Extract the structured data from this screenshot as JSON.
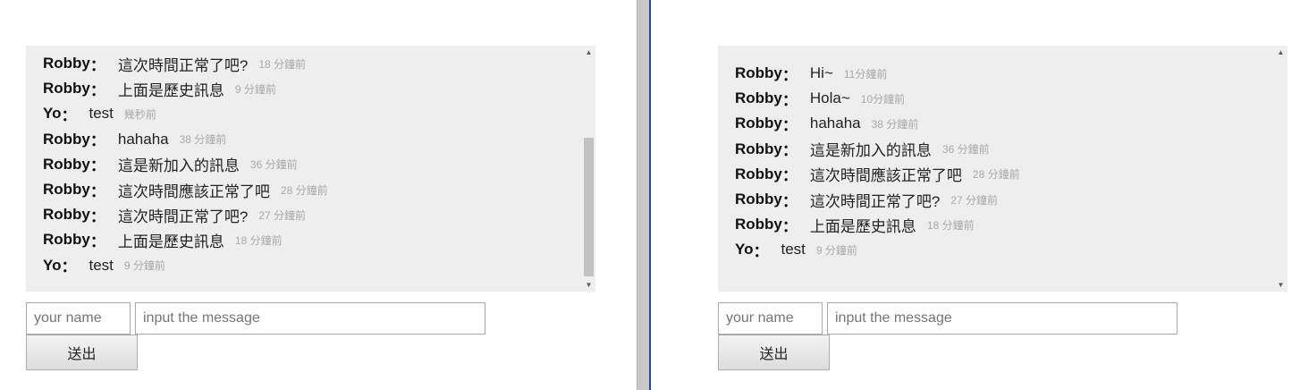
{
  "panes": [
    {
      "messages": [
        {
          "name": "Robby",
          "text": "這次時間正常了吧?",
          "time": "18 分鐘前"
        },
        {
          "name": "Robby",
          "text": "上面是歷史訊息",
          "time": "9 分鐘前"
        },
        {
          "name": "Yo",
          "text": "test",
          "time": "幾秒前"
        },
        {
          "name": "Robby",
          "text": "hahaha",
          "time": "38 分鐘前"
        },
        {
          "name": "Robby",
          "text": "這是新加入的訊息",
          "time": "36 分鐘前"
        },
        {
          "name": "Robby",
          "text": "這次時間應該正常了吧",
          "time": "28 分鐘前"
        },
        {
          "name": "Robby",
          "text": "這次時間正常了吧?",
          "time": "27 分鐘前"
        },
        {
          "name": "Robby",
          "text": "上面是歷史訊息",
          "time": "18 分鐘前"
        },
        {
          "name": "Yo",
          "text": "test",
          "time": "9 分鐘前"
        }
      ],
      "name_placeholder": "your name",
      "message_placeholder": "input the message",
      "send_label": "送出"
    },
    {
      "messages": [
        {
          "name": "Robby",
          "text": "Hi~",
          "time": "11分鐘前"
        },
        {
          "name": "Robby",
          "text": "Hola~",
          "time": "10分鐘前"
        },
        {
          "name": "Robby",
          "text": "hahaha",
          "time": "38 分鐘前"
        },
        {
          "name": "Robby",
          "text": "這是新加入的訊息",
          "time": "36 分鐘前"
        },
        {
          "name": "Robby",
          "text": "這次時間應該正常了吧",
          "time": "28 分鐘前"
        },
        {
          "name": "Robby",
          "text": "這次時間正常了吧?",
          "time": "27 分鐘前"
        },
        {
          "name": "Robby",
          "text": "上面是歷史訊息",
          "time": "18 分鐘前"
        },
        {
          "name": "Yo",
          "text": "test",
          "time": "9 分鐘前"
        }
      ],
      "name_placeholder": "your name",
      "message_placeholder": "input the message",
      "send_label": "送出"
    }
  ],
  "separator": "："
}
